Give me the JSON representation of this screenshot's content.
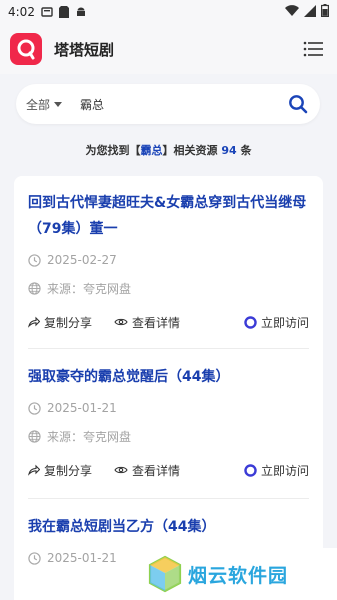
{
  "status_bar": {
    "time": "4:02"
  },
  "app": {
    "title": "塔塔短剧",
    "brand_color": "#f0284a"
  },
  "search": {
    "scope": "全部",
    "query": "霸总"
  },
  "summary": {
    "prefix": "为您找到【",
    "keyword": "霸总",
    "middle": "】相关资源 ",
    "count": "94",
    "suffix": " 条"
  },
  "results": [
    {
      "title": "回到古代悍妻超旺夫&女霸总穿到古代当继母（79集）董一",
      "date": "2025-02-27",
      "source": "来源：夸克网盘",
      "share": "复制分享",
      "detail": "查看详情",
      "visit": "立即访问"
    },
    {
      "title": "强取豪夺的霸总觉醒后（44集）",
      "date": "2025-01-21",
      "source": "来源：夸克网盘",
      "share": "复制分享",
      "detail": "查看详情",
      "visit": "立即访问"
    },
    {
      "title": "我在霸总短剧当乙方（44集）",
      "date": "2025-01-21"
    }
  ],
  "watermark": {
    "text": "烟云软件园"
  },
  "colors": {
    "title_blue": "#1a3fae",
    "accent_blue": "#1a44b8",
    "visit_ring": "#3b3bd6"
  }
}
